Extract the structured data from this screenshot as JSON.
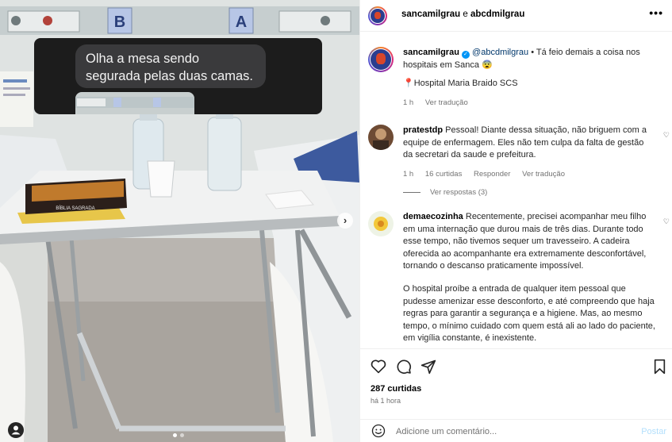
{
  "media": {
    "overlay_text": "Olha a mesa sendo segurada pelas duas camas.",
    "bed_labels": [
      "B",
      "A"
    ],
    "book_title": "BÍBLIA SAGRADA",
    "carousel_dots": 2,
    "active_dot": 1
  },
  "header": {
    "author": "sancamilgrau",
    "connector": "e",
    "coauthor": "abcdmilgrau",
    "more_label": "•••"
  },
  "caption": {
    "author": "sancamilgrau",
    "mention": "@abcdmilgrau",
    "text": " • Tá feio demais a coisa nos hospitais em Sanca 😨",
    "location": "Hospital Maria Braido SCS",
    "time": "1 h",
    "translate": "Ver tradução"
  },
  "comments": [
    {
      "author": "pratestdp",
      "text": " Pessoal! Diante dessa situação, não briguem com a equipe de enfermagem. Eles não tem culpa da falta de gestão da secretari da saude e prefeitura.",
      "time": "1 h",
      "likes": "16 curtidas",
      "reply": "Responder",
      "translate": "Ver tradução",
      "view_replies": "Ver respostas (3)"
    },
    {
      "author": "demaecozinha",
      "text": " Recentemente, precisei acompanhar meu filho em uma internação que durou mais de três dias. Durante todo esse tempo, não tivemos sequer um travesseiro. A cadeira oferecida ao acompanhante era extremamente desconfortável, tornando o descanso praticamente impossível.",
      "text2": "O hospital proíbe a entrada de qualquer item pessoal que pudesse amenizar esse desconforto, e até compreendo que haja regras para garantir a segurança e a higiene. Mas, ao mesmo tempo, o mínimo cuidado com quem está ali ao lado do paciente, em vigília constante, é inexistente."
    }
  ],
  "footer": {
    "likes": "287 curtidas",
    "time": "há 1 hora",
    "comment_placeholder": "Adicione um comentário...",
    "post_label": "Postar"
  },
  "icons": {
    "heart": "heart-icon",
    "comment": "comment-icon",
    "share": "share-icon",
    "save": "bookmark-icon",
    "emoji": "emoji-icon",
    "location": "location-pin-icon",
    "verified": "verified-badge-icon",
    "user_tag": "user-tag-icon",
    "next": "chevron-right-icon"
  }
}
